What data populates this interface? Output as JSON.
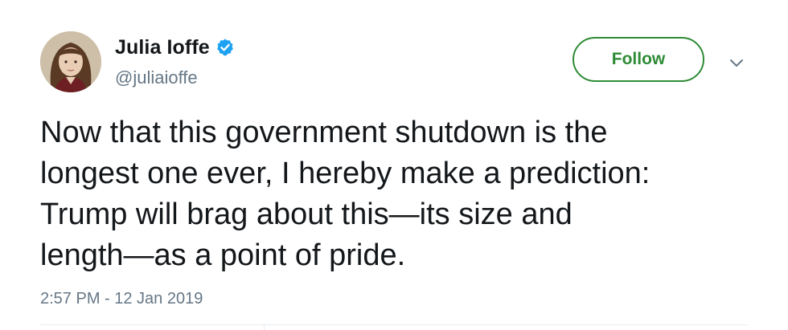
{
  "user": {
    "display_name": "Julia Ioffe",
    "handle": "@juliaioffe",
    "verified": true,
    "avatar_icon": "user-avatar-photo"
  },
  "actions": {
    "follow_label": "Follow",
    "menu_icon": "chevron-down-icon"
  },
  "tweet": {
    "text": "Now that this government shutdown is the\nlongest one ever, I hereby make a prediction:\nTrump will brag about this—its size and\nlength—as a point of pride.",
    "timestamp": "2:57 PM - 12 Jan 2019"
  },
  "colors": {
    "follow_accent": "#2e8b35",
    "verified_badge": "#1da1f2",
    "secondary_text": "#657786",
    "primary_text": "#14171a"
  }
}
